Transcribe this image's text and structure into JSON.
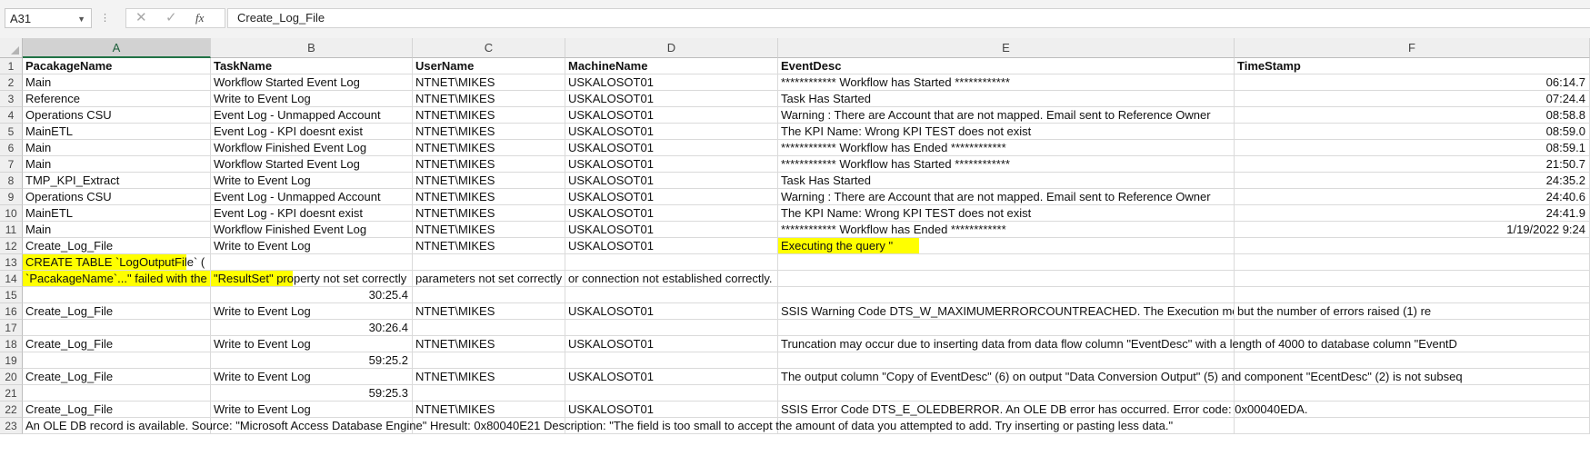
{
  "formula_bar": {
    "name_box": "A31",
    "dropdown_icon": "chevron-down-icon",
    "cancel_icon": "✕",
    "enter_icon": "✓",
    "fx_label": "fx",
    "content": "Create_Log_File"
  },
  "columns": [
    "A",
    "B",
    "C",
    "D",
    "E",
    "F"
  ],
  "rows": [
    {
      "n": "1",
      "a": "PacakageName",
      "b": "TaskName",
      "c": "UserName",
      "d": "MachineName",
      "e": "EventDesc",
      "f": "TimeStamp"
    },
    {
      "n": "2",
      "a": "Main",
      "b": "Workflow Started Event Log",
      "c": "NTNET\\MIKES",
      "d": "USKALOSOT01",
      "e": "************ Workflow has Started ************",
      "f": "06:14.7"
    },
    {
      "n": "3",
      "a": "Reference",
      "b": "Write to Event Log",
      "c": "NTNET\\MIKES",
      "d": "USKALOSOT01",
      "e": "Task Has Started",
      "f": "07:24.4"
    },
    {
      "n": "4",
      "a": "Operations CSU",
      "b": "Event Log - Unmapped Account",
      "c": "NTNET\\MIKES",
      "d": "USKALOSOT01",
      "e": "Warning : There are Account that are not mapped. Email sent to Reference Owner",
      "f": "08:58.8"
    },
    {
      "n": "5",
      "a": "MainETL",
      "b": "Event Log - KPI doesnt exist",
      "c": "NTNET\\MIKES",
      "d": "USKALOSOT01",
      "e": "The KPI Name: Wrong KPI TEST does not exist",
      "f": "08:59.0"
    },
    {
      "n": "6",
      "a": "Main",
      "b": "Workflow Finished Event Log",
      "c": "NTNET\\MIKES",
      "d": "USKALOSOT01",
      "e": "************ Workflow has Ended ************",
      "f": "08:59.1"
    },
    {
      "n": "7",
      "a": "Main",
      "b": "Workflow Started Event Log",
      "c": "NTNET\\MIKES",
      "d": "USKALOSOT01",
      "e": "************ Workflow has Started ************",
      "f": "21:50.7"
    },
    {
      "n": "8",
      "a": "TMP_KPI_Extract",
      "b": "Write to Event Log",
      "c": "NTNET\\MIKES",
      "d": "USKALOSOT01",
      "e": "Task Has Started",
      "f": "24:35.2"
    },
    {
      "n": "9",
      "a": "Operations CSU",
      "b": "Event Log - Unmapped Account",
      "c": "NTNET\\MIKES",
      "d": "USKALOSOT01",
      "e": "Warning : There are Account that are not mapped. Email sent to Reference Owner",
      "f": "24:40.6"
    },
    {
      "n": "10",
      "a": "MainETL",
      "b": "Event Log - KPI doesnt exist",
      "c": "NTNET\\MIKES",
      "d": "USKALOSOT01",
      "e": "The KPI Name: Wrong KPI TEST does not exist",
      "f": "24:41.9"
    },
    {
      "n": "11",
      "a": "Main",
      "b": "Workflow Finished Event Log",
      "c": "NTNET\\MIKES",
      "d": "USKALOSOT01",
      "e": "************ Workflow has Ended ************",
      "f": "1/19/2022 9:24"
    },
    {
      "n": "12",
      "a": "Create_Log_File",
      "b": "Write to Event Log",
      "c": "NTNET\\MIKES",
      "d": "USKALOSOT01",
      "e": "Executing the query \"",
      "f": ""
    },
    {
      "n": "13",
      "a": "CREATE TABLE `LogOutputFile` (",
      "b": "",
      "c": "",
      "d": "",
      "e": "",
      "f": ""
    },
    {
      "n": "14",
      "a": "   `PacakageName`...\" failed with the f",
      "b": "\"ResultSet\" property not set correctly",
      "c": " parameters not set correctly",
      "d": " or connection not established correctly.",
      "e": "",
      "f": ""
    },
    {
      "n": "15",
      "a": "",
      "b": "30:25.4",
      "c": "",
      "d": "",
      "e": "",
      "f": ""
    },
    {
      "n": "16",
      "a": "Create_Log_File",
      "b": "Write to Event Log",
      "c": "NTNET\\MIKES",
      "d": "USKALOSOT01",
      "e": "SSIS Warning Code DTS_W_MAXIMUMERRORCOUNTREACHED.  The Execution method succ",
      "f": "but the number of errors raised (1) re"
    },
    {
      "n": "17",
      "a": "",
      "b": "30:26.4",
      "c": "",
      "d": "",
      "e": "",
      "f": ""
    },
    {
      "n": "18",
      "a": "Create_Log_File",
      "b": "Write to Event Log",
      "c": "NTNET\\MIKES",
      "d": "USKALOSOT01",
      "e": "Truncation may occur due to inserting data from data flow column \"EventDesc\" with a length of 4000 to database column \"EventD",
      "f": ""
    },
    {
      "n": "19",
      "a": "",
      "b": "59:25.2",
      "c": "",
      "d": "",
      "e": "",
      "f": ""
    },
    {
      "n": "20",
      "a": "Create_Log_File",
      "b": "Write to Event Log",
      "c": "NTNET\\MIKES",
      "d": "USKALOSOT01",
      "e": "The output column \"Copy of EventDesc\" (6) on output \"Data Conversion Output\" (5) and component \"EcentDesc\" (2) is not subseq",
      "f": ""
    },
    {
      "n": "21",
      "a": "",
      "b": "59:25.3",
      "c": "",
      "d": "",
      "e": "",
      "f": ""
    },
    {
      "n": "22",
      "a": "Create_Log_File",
      "b": "Write to Event Log",
      "c": "NTNET\\MIKES",
      "d": "USKALOSOT01",
      "e": "SSIS Error Code DTS_E_OLEDBERROR.  An OLE DB error has occurred. Error code: 0x00040EDA.",
      "f": ""
    },
    {
      "n": "23",
      "a": "An OLE DB record is available.  Source: \"Microsoft Access Database Engine\"  Hresult: 0x80040E21  Description: \"The field is too small to accept the amount of data you attempted to add. Try inserting or pasting less data.\"",
      "b": "",
      "c": "",
      "d": "",
      "e": "",
      "f": ""
    }
  ],
  "colors": {
    "selection": "#217346",
    "highlight": "#ffff00"
  }
}
